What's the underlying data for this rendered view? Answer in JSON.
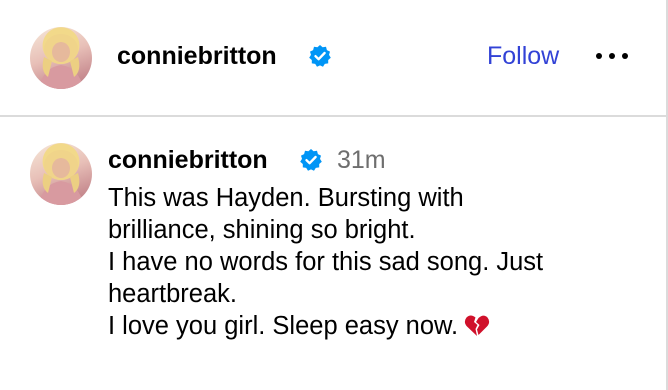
{
  "header": {
    "username": "conniebritton",
    "follow_label": "Follow",
    "more_icon": "more-horizontal-icon",
    "verified_icon": "verified-badge-icon"
  },
  "post": {
    "username": "conniebritton",
    "timestamp": "31m",
    "caption_lines": [
      "This was Hayden. Bursting with",
      "brilliance, shining so bright.",
      "I have no words for this sad song. Just",
      "heartbreak.",
      "I love you girl. Sleep easy now."
    ],
    "emoji_icon": "broken-heart-icon"
  },
  "colors": {
    "follow": "#3242d6",
    "verified": "#0095f6",
    "timestamp": "#6e6e6e",
    "divider": "#dbdbdb",
    "broken_heart": "#d0112b"
  }
}
